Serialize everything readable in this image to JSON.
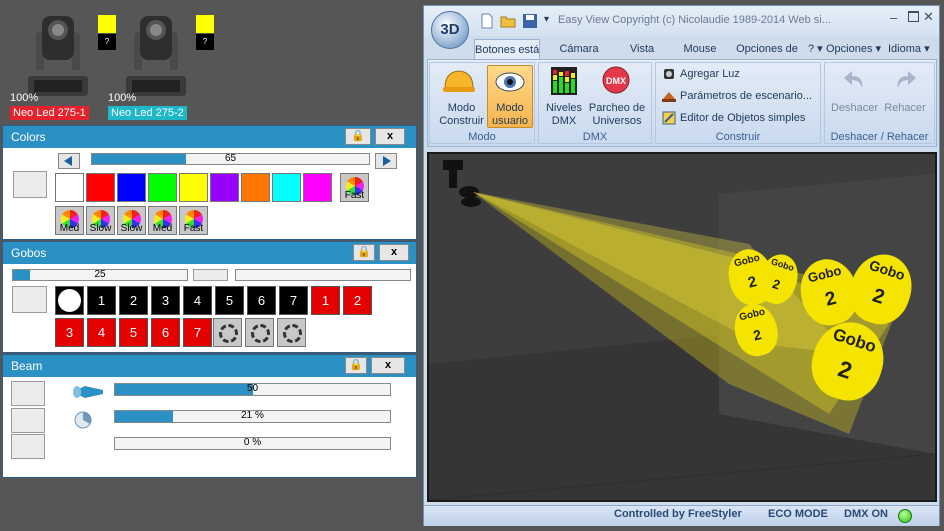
{
  "fixtures": [
    {
      "percent": "100%",
      "label": "Neo Led 275-1",
      "label_color": "#e8222c",
      "swatch_color": "#ffff00",
      "q": "?"
    },
    {
      "percent": "100%",
      "label": "Neo Led 275-2",
      "label_color": "#1fb8c8",
      "swatch_color": "#ffff00",
      "q": "?"
    }
  ],
  "colors_panel": {
    "title": "Colors",
    "slider_value": "65",
    "slider_fraction": 0.34,
    "swatches": [
      "#ffffff",
      "#ff0000",
      "#0000ff",
      "#00ff00",
      "#ffff00",
      "#9900ff",
      "#ff7700",
      "#00ffff",
      "#ff00ff"
    ],
    "effects_row1": [
      "Fast"
    ],
    "effects_row2": [
      "Med",
      "Slow",
      "Slow",
      "Med",
      "Fast"
    ]
  },
  "gobos_panel": {
    "title": "Gobos",
    "slider_value": "25",
    "slider_fraction": 0.1,
    "row1": [
      "",
      "1",
      "2",
      "3",
      "4",
      "5",
      "6",
      "7",
      "1",
      "2"
    ],
    "row2": [
      "3",
      "4",
      "5",
      "6",
      "7"
    ]
  },
  "beam_panel": {
    "title": "Beam",
    "bars": [
      {
        "value": "50",
        "fraction": 0.5
      },
      {
        "value": "21 %",
        "fraction": 0.21
      },
      {
        "value": "0 %",
        "fraction": 0.0
      }
    ]
  },
  "app": {
    "logo": "3D",
    "title": "Easy View   Copyright (c) Nicolaudie 1989-2014   Web si...",
    "tabs": [
      "Botones está",
      "Cámara",
      "Vista",
      "Mouse",
      "Opciones de"
    ],
    "menu_extra": [
      "?",
      "Opciones",
      "Idioma"
    ],
    "groups": {
      "modo": {
        "label": "Modo",
        "buttons": [
          "Modo\nConstruir",
          "Modo\nusuario"
        ]
      },
      "dmx": {
        "label": "DMX",
        "buttons": [
          "Niveles\nDMX",
          "Parcheo de\nUniversos"
        ]
      },
      "construir": {
        "label": "Construir",
        "items": [
          "Agregar Luz",
          "Parámetros de escenario...",
          "Editor de Objetos simples"
        ]
      },
      "deshacer": {
        "label": "Deshacer / Rehacer",
        "buttons": [
          "Deshacer",
          "Rehacer"
        ]
      }
    },
    "gobo_text": "Gobo",
    "gobo_number": "2",
    "status": {
      "controlled": "Controlled by FreeStyler",
      "eco": "ECO MODE",
      "dmx": "DMX ON"
    }
  }
}
